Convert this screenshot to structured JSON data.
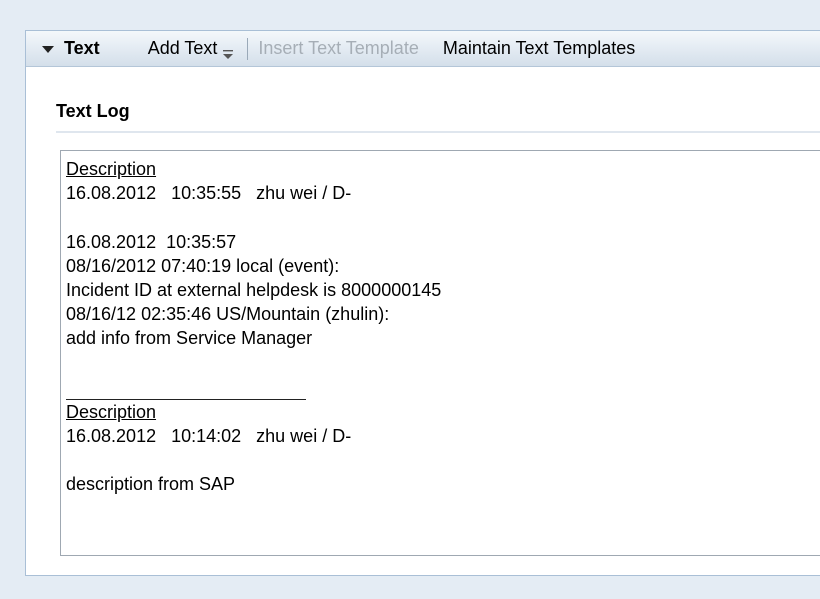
{
  "toolbar": {
    "text_toggle_label": "Text",
    "add_text_label": "Add Text",
    "insert_template_label": "Insert Text Template",
    "maintain_templates_label": "Maintain Text Templates"
  },
  "section": {
    "title": "Text Log"
  },
  "log": {
    "entries": [
      {
        "heading": "Description",
        "meta": "16.08.2012   10:35:55   zhu wei / D-",
        "body": [
          "16.08.2012  10:35:57",
          "08/16/2012 07:40:19 local (event):",
          "Incident ID at external helpdesk is 8000000145",
          "08/16/12 02:35:46 US/Mountain (zhulin):",
          "add info from Service Manager"
        ]
      },
      {
        "heading": "Description",
        "meta": "16.08.2012   10:14:02   zhu wei / D-",
        "body": [
          "description from SAP"
        ]
      }
    ]
  }
}
